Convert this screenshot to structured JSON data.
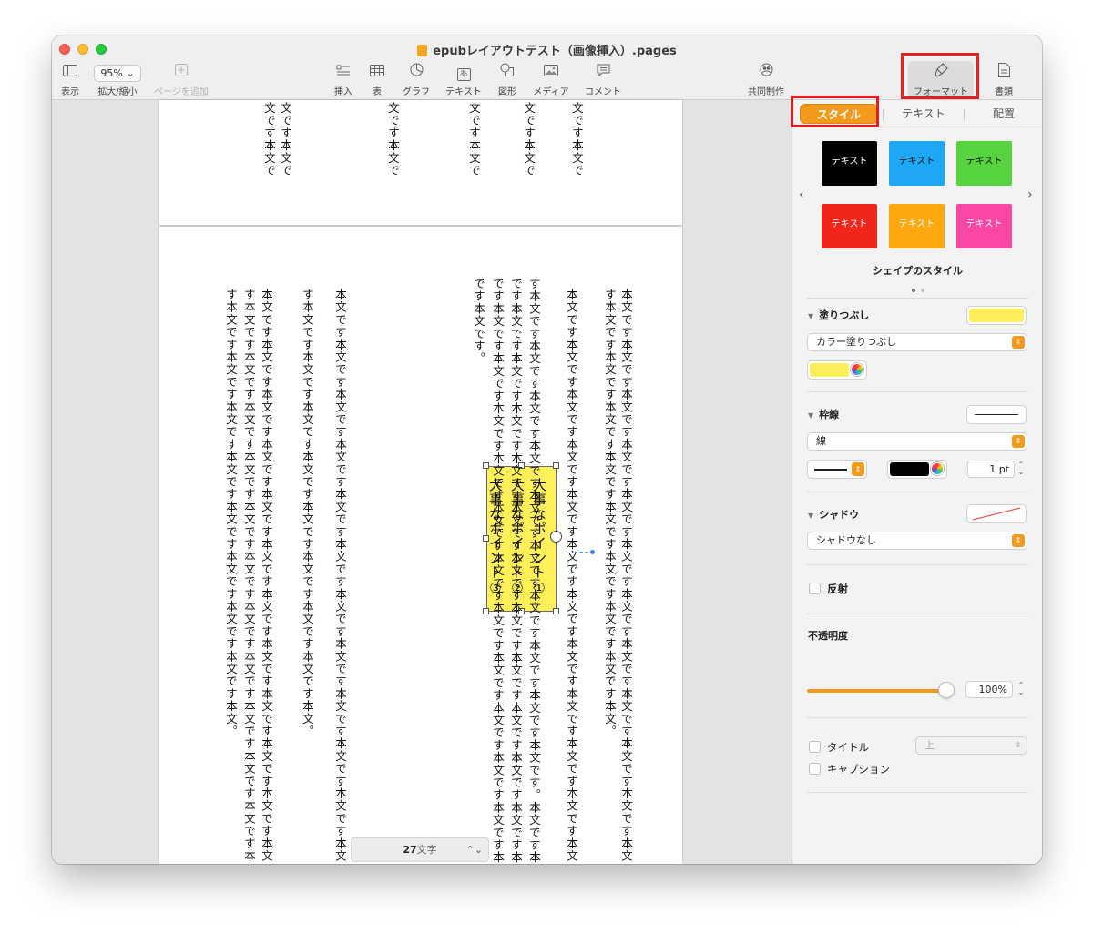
{
  "window": {
    "title": "epubレイアウトテスト（画像挿入）.pages"
  },
  "toolbar": {
    "view": {
      "label": "表示",
      "icon": "sidebar-icon"
    },
    "zoom": {
      "value": "95%",
      "label": "拡大/縮小"
    },
    "add_page": {
      "label": "ページを追加",
      "icon": "plus-square-icon"
    },
    "insert": {
      "label": "挿入",
      "icon": "insert-list-icon"
    },
    "table": {
      "label": "表",
      "icon": "table-icon"
    },
    "chart": {
      "label": "グラフ",
      "icon": "pie-chart-icon"
    },
    "text": {
      "label": "テキスト",
      "icon": "text-box-icon",
      "glyph": "あ"
    },
    "shape": {
      "label": "図形",
      "icon": "shape-icon"
    },
    "media": {
      "label": "メディア",
      "icon": "image-icon"
    },
    "comment": {
      "label": "コメント",
      "icon": "comment-icon"
    },
    "collaborate": {
      "label": "共同制作",
      "icon": "collaborate-icon"
    },
    "format": {
      "label": "フォーマット",
      "icon": "paintbrush-icon"
    },
    "document": {
      "label": "書類",
      "icon": "document-icon"
    }
  },
  "document": {
    "page1_columns": [
      "文です本文で",
      "文です本文で",
      "文です本文で",
      "文です本文で",
      "文です本文で",
      "文です本文で"
    ],
    "page2_columns": [
      "本文です本文です本文です本文です本文です本文です本文です本文です本文です本文です本文です本文です本文です本文です本文です本文です本文です本文で",
      "す本文です本文です本文です本文です本文です本文です本文です本文です本文。",
      "本文です本文です本文です本文です本文です本文です本文です本文です本文です本文です本文です本文です本文です本文です本文です本文です本文です本文で",
      "す本文です本文です本文です本文です本文です本文です本文です本文です本文です本文です。本文です本文です本文です本文です本文です本文です本文で",
      "です本文です本文です本文です本文です本文です本文です本文です本文です本文です本文です本文です本文です本文です本文です本文です本文です本文で",
      "です本文です本文です本文です本文です本文です本文です本文です本文です本文です本文です本文です本文です本文です本文です本文です本文です本文で",
      "です本文です。",
      "本文です本文です本文です本文です本文です本文です本文です本文です本文です本文です本文です本文です本文です本文です本文です本文です本文です本文で",
      "す本文です本文です本文です本文です本文です本文です本文です本文です本文。",
      "本文です本文です本文です本文です本文です本文です本文です本文です本文です本文です本文です本文です本文です本文です本文です本文です本文です本文で",
      "す本文です本文です本文です本文です本文です本文です本文です本文です本文です本文です本文です本文です本文です本文です本文です本文です本文で",
      "す本文です本文です本文です本文です本文です本文です本文です本文です本文。"
    ],
    "shape_text": [
      "大事なポイント①",
      "大事なポイント②",
      "大事なポイント③"
    ],
    "shape_fill": "#fff05a"
  },
  "word_count": {
    "count": "27",
    "unit": "文字"
  },
  "inspector": {
    "tabs": [
      "スタイル",
      "テキスト",
      "配置"
    ],
    "active_tab": "スタイル",
    "style_swatches": [
      {
        "label": "テキスト",
        "bg": "#000000",
        "fg": "#ffffff"
      },
      {
        "label": "テキスト",
        "bg": "#1ea7f5",
        "fg": "#111111"
      },
      {
        "label": "テキスト",
        "bg": "#57d33f",
        "fg": "#111111"
      },
      {
        "label": "テキスト",
        "bg": "#f2251b",
        "fg": "#ffffff"
      },
      {
        "label": "テキスト",
        "bg": "#fca80e",
        "fg": "#ffffff"
      },
      {
        "label": "テキスト",
        "bg": "#fa47a4",
        "fg": "#ffffff"
      }
    ],
    "shape_styles_title": "シェイプのスタイル",
    "fill": {
      "label": "塗りつぶし",
      "type": "カラー塗りつぶし",
      "color": "#fdee5a"
    },
    "border": {
      "label": "枠線",
      "type": "線",
      "color": "#000000",
      "width": "1 pt"
    },
    "shadow": {
      "label": "シャドウ",
      "type": "シャドウなし"
    },
    "reflection": {
      "label": "反射"
    },
    "opacity": {
      "label": "不透明度",
      "value": "100%",
      "level": 1.0
    },
    "title_option": {
      "label": "タイトル",
      "position": "上"
    },
    "caption_option": {
      "label": "キャプション"
    }
  },
  "colors": {
    "accent": "#f39a1c",
    "highlight_box": "#e81e1e"
  }
}
